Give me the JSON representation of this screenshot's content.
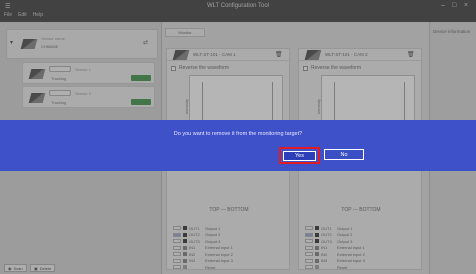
{
  "window": {
    "title": "WLT Configuration Tool",
    "menu": [
      "File",
      "Edit",
      "Help"
    ]
  },
  "sidebar": {
    "main_device": {
      "line1": "Sensor name",
      "line2": "CH8888E"
    },
    "sub_devices": [
      {
        "line1": "Sensor 1",
        "line2": "Tracking",
        "badge": ""
      },
      {
        "line1": "Sensor 2",
        "line2": "Tracking",
        "badge": ""
      }
    ],
    "footer_buttons": [
      {
        "label": "Scan"
      },
      {
        "label": "Delete"
      }
    ]
  },
  "main": {
    "tab_label": "Monitor",
    "panels": [
      {
        "title": "WLT-ST-101 - CAM 1",
        "checkbox_label": "Reverse the waveform",
        "ylabel": "Intensity",
        "orientation": "TOP --- BOTTOM",
        "io_rows": [
          {
            "code": "OUT1",
            "label": "Output 1"
          },
          {
            "code": "OUT2",
            "label": "Output 2"
          },
          {
            "code": "OUT3",
            "label": "Output 3"
          },
          {
            "code": "IN1",
            "label": "External input 1"
          },
          {
            "code": "IN2",
            "label": "External input 2"
          },
          {
            "code": "IN3",
            "label": "External input 3"
          },
          {
            "code": "",
            "label": "Reset"
          }
        ]
      },
      {
        "title": "WLT-ST-101 - CAM 2",
        "checkbox_label": "Reverse the waveform",
        "ylabel": "Intensity",
        "orientation": "TOP --- BOTTOM",
        "io_rows": [
          {
            "code": "OUT1",
            "label": "Output 1"
          },
          {
            "code": "OUT2",
            "label": "Output 2"
          },
          {
            "code": "OUT3",
            "label": "Output 3"
          },
          {
            "code": "IN1",
            "label": "External input 1"
          },
          {
            "code": "IN2",
            "label": "External input 2"
          },
          {
            "code": "IN3",
            "label": "External input 3"
          },
          {
            "code": "",
            "label": "Reset"
          }
        ]
      }
    ]
  },
  "right_pane": {
    "header": "Device information"
  },
  "dialog": {
    "question": "Do you want to remove it from the monitoring target?",
    "yes_label": "Yes",
    "no_label": "No"
  },
  "colors": {
    "banner": "#3f51c9",
    "highlight": "#e31b22",
    "badge_green": "#2e8b3a"
  }
}
